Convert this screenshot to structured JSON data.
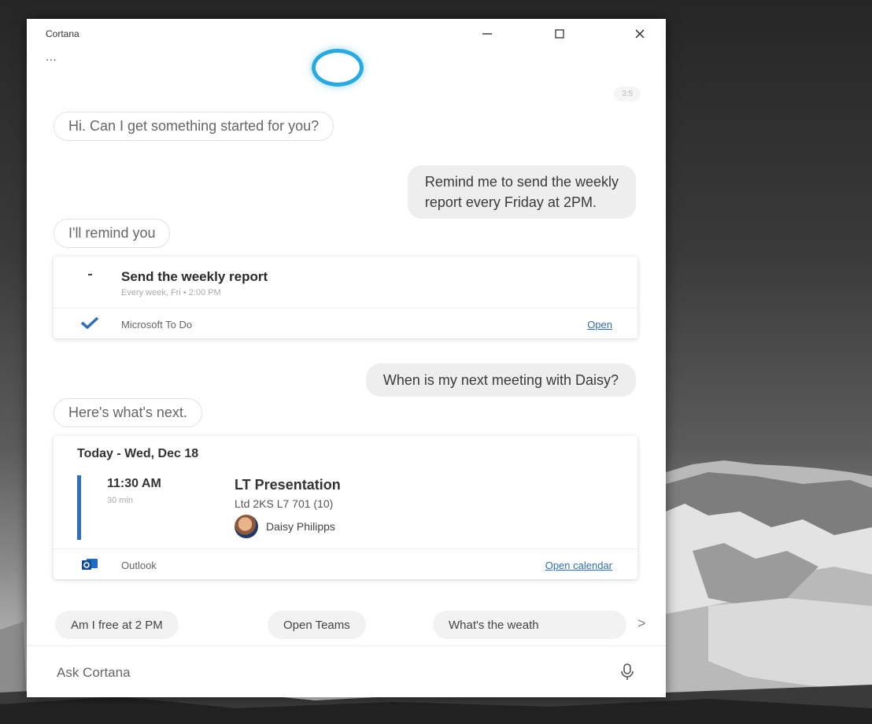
{
  "window": {
    "app_title": "Cortana",
    "more_label": "...",
    "timestamp": "3:5"
  },
  "conversation": {
    "greeting": "Hi. Can I get something started for you?",
    "user_request_1_line1": "Remind me to send the weekly",
    "user_request_1_line2": "report every Friday at 2PM.",
    "reply_1": "I'll remind you",
    "reminder_card": {
      "title": "Send the weekly report",
      "subtitle": "Every week, Fri • 2:00 PM",
      "source_label": "Microsoft To Do",
      "action_label": "Open"
    },
    "user_request_2": "When is my next meeting with Daisy?",
    "reply_2": "Here's what's next.",
    "calendar_card": {
      "header": "Today - Wed, Dec 18",
      "time": "11:30 AM",
      "duration": "30 min",
      "title": "LT Presentation",
      "location": "Ltd 2KS L7 701 (10)",
      "attendee": "Daisy Philipps",
      "source_label": "Outlook",
      "action_label": "Open calendar"
    }
  },
  "suggestions": [
    "Am I free at 2 PM",
    "Open Teams",
    "What's the weath"
  ],
  "suggestions_more": ">",
  "ask": {
    "placeholder": "Ask Cortana"
  },
  "colors": {
    "accent": "#27a9e1",
    "calendar_bar": "#2f6fb7",
    "todo_check": "#2f6fb7",
    "link": "#2c6fb8"
  }
}
